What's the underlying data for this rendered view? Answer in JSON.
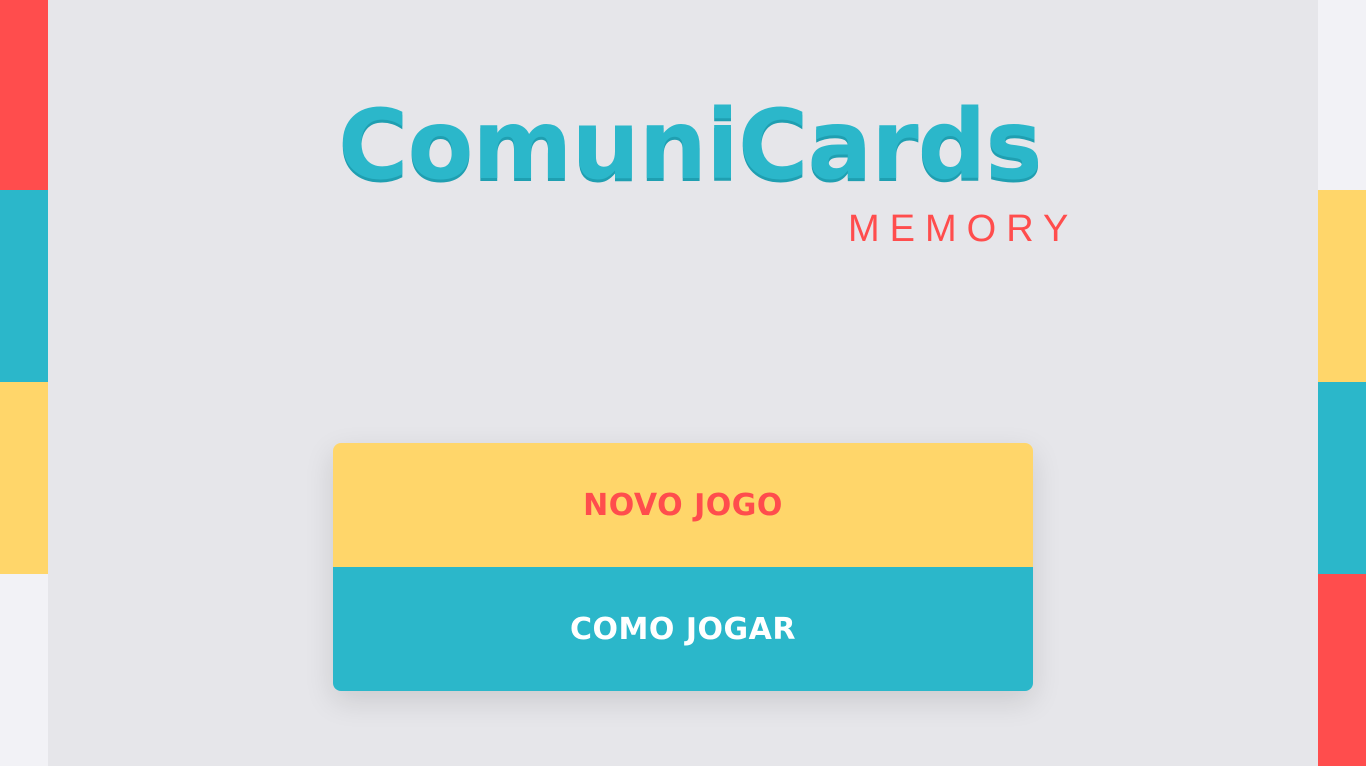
{
  "colors": {
    "background": "#e6e6ea",
    "red": "#ff4d4d",
    "teal": "#2bb7ca",
    "yellow": "#ffd66a",
    "light": "#f2f2f6"
  },
  "logo": {
    "title": "ComuniCards",
    "subtitle": "MEMORY"
  },
  "menu": {
    "new_game_label": "NOVO JOGO",
    "how_to_play_label": "COMO JOGAR"
  },
  "side_left": [
    "#ff4d4d",
    "#2bb7ca",
    "#ffd66a",
    "#f2f2f6"
  ],
  "side_right": [
    "#f2f2f6",
    "#ffd66a",
    "#2bb7ca",
    "#ff4d4d"
  ]
}
